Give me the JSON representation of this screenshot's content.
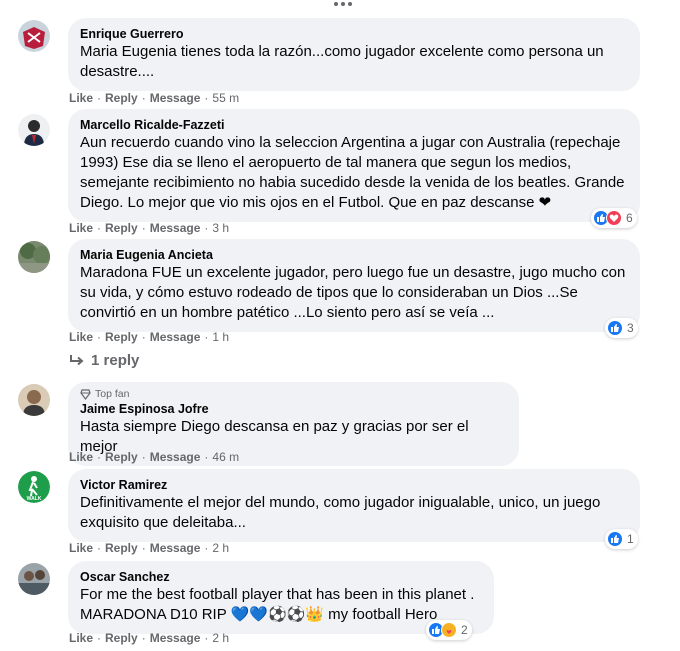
{
  "comments": [
    {
      "author": "Enrique Guerrero",
      "text": "Maria Eugenia tienes toda la razón...como jugador excelente como persona un desastre....",
      "like": "Like",
      "reply": "Reply",
      "message": "Message",
      "time": "55 m"
    },
    {
      "author": "Marcello Ricalde-Fazzeti",
      "text": "Aun recuerdo cuando vino la seleccion Argentina a jugar con Australia (repechaje 1993) Ese dia se lleno el aeropuerto de tal manera que segun los medios, semejante recibimiento no habia sucedido desde la venida de los beatles. Grande Diego. Lo mejor que vio mis ojos en el Futbol. Que en paz descanse ❤",
      "like": "Like",
      "reply": "Reply",
      "message": "Message",
      "time": "3 h",
      "reaction_count": "6"
    },
    {
      "author": "Maria Eugenia Ancieta",
      "text": "Maradona FUE un excelente jugador, pero luego fue un desastre, jugo mucho con su vida, y cómo estuvo rodeado de tipos que lo consideraban un Dios ...Se convirtió en un hombre patético ...Lo siento pero así se veía ...",
      "like": "Like",
      "reply": "Reply",
      "message": "Message",
      "time": "1 h",
      "reaction_count": "3",
      "replies_label": "1 reply"
    },
    {
      "badge": "Top fan",
      "author": "Jaime Espinosa Jofre",
      "text": "Hasta siempre Diego descansa en paz y gracias por ser el mejor",
      "like": "Like",
      "reply": "Reply",
      "message": "Message",
      "time": "46 m"
    },
    {
      "author": "Victor Ramirez",
      "text": "Definitivamente el mejor del mundo, como jugador inigualable, unico, un juego exquisito que deleitaba...",
      "like": "Like",
      "reply": "Reply",
      "message": "Message",
      "time": "2 h",
      "reaction_count": "1"
    },
    {
      "author": "Oscar Sanchez",
      "text": "For me the best football player that has been in this planet . MARADONA D10 RIP 💙💙⚽⚽👑 my football Hero",
      "like": "Like",
      "reply": "Reply",
      "message": "Message",
      "time": "2 h",
      "reaction_count": "2"
    }
  ],
  "separator": "·",
  "colors": {
    "bubble": "#f0f2f5",
    "meta": "#65676b",
    "like": "#1877f2",
    "love": "#f33e58",
    "care": "#f7b125"
  },
  "icons": [
    "more-icon",
    "like-reaction-icon",
    "love-reaction-icon",
    "care-reaction-icon",
    "reply-arrow-icon",
    "top-fan-badge-icon"
  ]
}
